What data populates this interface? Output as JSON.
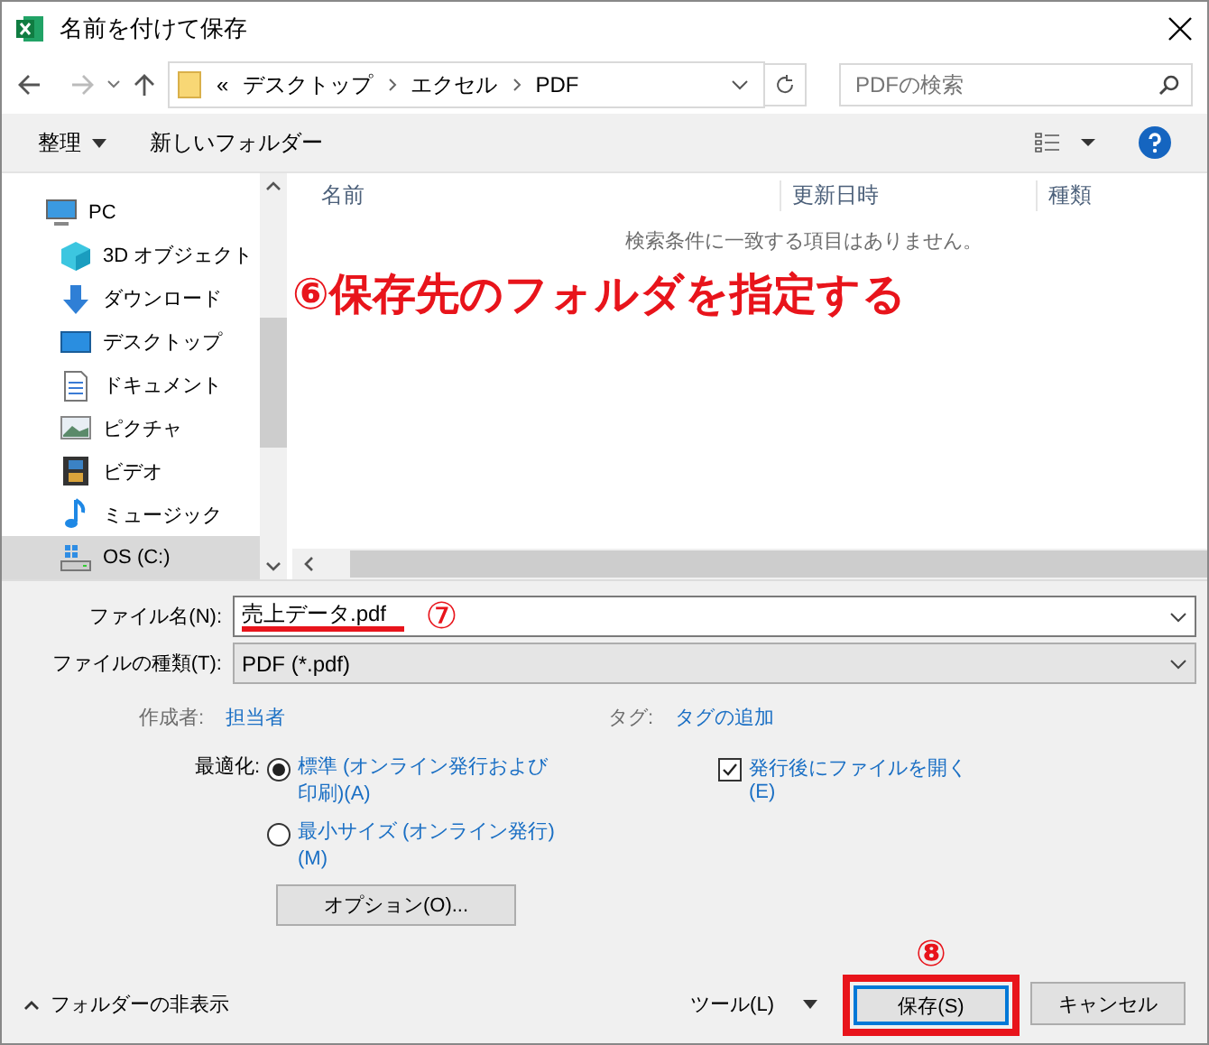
{
  "window": {
    "title": "名前を付けて保存"
  },
  "address": {
    "overflow": "«",
    "path": [
      "デスクトップ",
      "エクセル",
      "PDF"
    ]
  },
  "search": {
    "placeholder": "PDFの検索"
  },
  "toolbar": {
    "organize": "整理",
    "new_folder": "新しいフォルダー"
  },
  "sidebar": {
    "items": [
      {
        "label": "PC",
        "kind": "pc",
        "selected": false
      },
      {
        "label": "3D オブジェクト",
        "kind": "cube",
        "selected": false
      },
      {
        "label": "ダウンロード",
        "kind": "download",
        "selected": false
      },
      {
        "label": "デスクトップ",
        "kind": "desktop",
        "selected": false
      },
      {
        "label": "ドキュメント",
        "kind": "document",
        "selected": false
      },
      {
        "label": "ピクチャ",
        "kind": "picture",
        "selected": false
      },
      {
        "label": "ビデオ",
        "kind": "video",
        "selected": false
      },
      {
        "label": "ミュージック",
        "kind": "music",
        "selected": false
      },
      {
        "label": "OS (C:)",
        "kind": "drive",
        "selected": true
      }
    ]
  },
  "file_list": {
    "columns": [
      "名前",
      "更新日時",
      "種類"
    ],
    "empty_message": "検索条件に一致する項目はありません。"
  },
  "annotation_6": "⑥保存先のフォルダを指定する",
  "file_name": {
    "label": "ファイル名(N):",
    "value": "売上データ.pdf",
    "annotation": "⑦"
  },
  "file_type": {
    "label": "ファイルの種類(T):",
    "value": "PDF (*.pdf)"
  },
  "author": {
    "label": "作成者:",
    "value": "担当者"
  },
  "tags": {
    "label": "タグ:",
    "value": "タグの追加"
  },
  "optimize": {
    "label": "最適化:",
    "options": [
      {
        "label": "標準 (オンライン発行および印刷)(A)",
        "selected": true
      },
      {
        "label": "最小サイズ (オンライン発行)(M)",
        "selected": false
      }
    ]
  },
  "open_after": {
    "label": "発行後にファイルを開く(E)",
    "checked": true
  },
  "options_button": "オプション(O)...",
  "hide_folders": "フォルダーの非表示",
  "tools": "ツール(L)",
  "save_annotation": "⑧",
  "save": "保存(S)",
  "cancel": "キャンセル"
}
